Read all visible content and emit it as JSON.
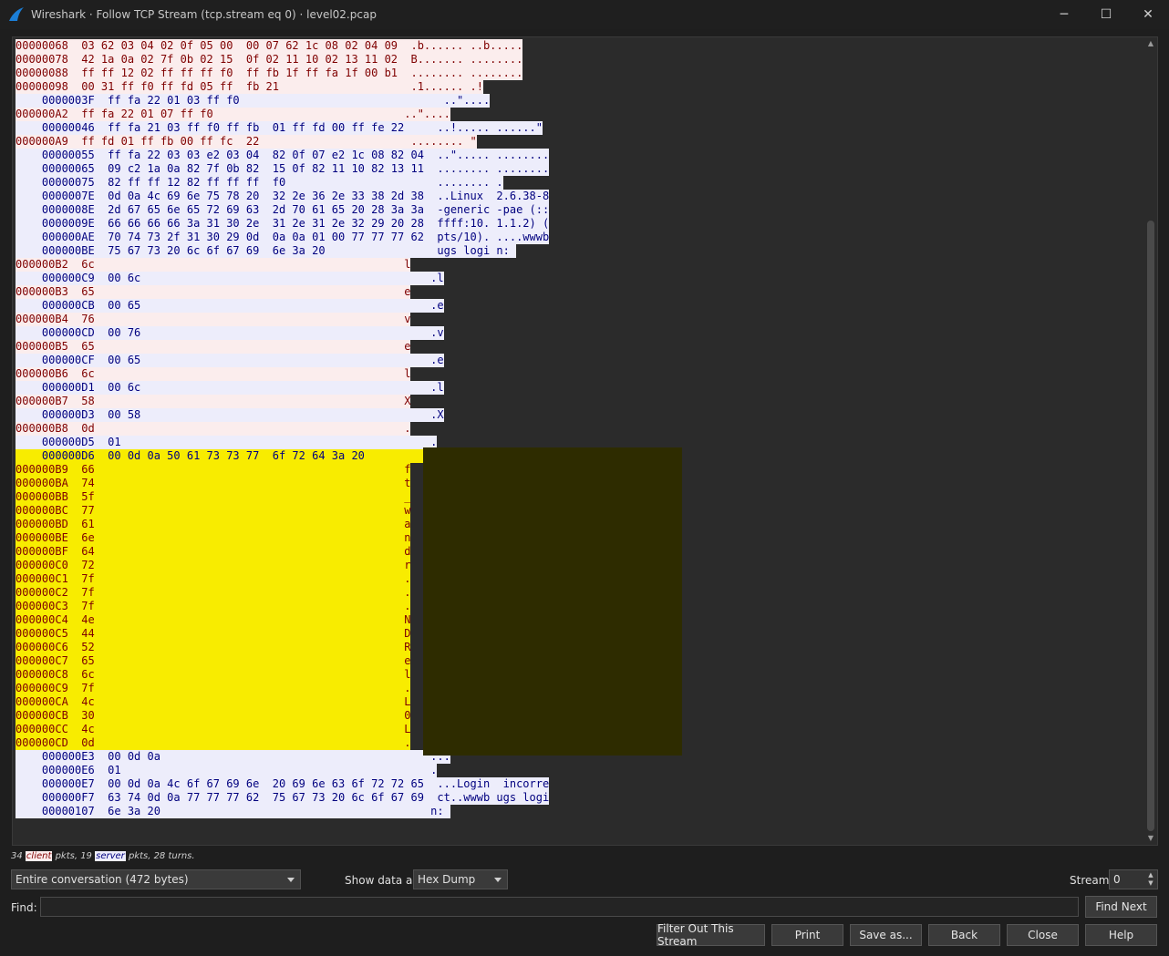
{
  "window": {
    "title": "Wireshark · Follow TCP Stream (tcp.stream eq 0) · level02.pcap",
    "minimize": "─",
    "maximize": "☐",
    "close": "✕"
  },
  "stream": {
    "colors": {
      "client_bg": "#fbeded",
      "client_fg": "#7f0000",
      "server_bg": "#ededfb",
      "server_fg": "#00007f",
      "highlight": "#f8ec00"
    },
    "lines": [
      {
        "who": "c",
        "text": "00000068  03 62 03 04 02 0f 05 00  00 07 62 1c 08 02 04 09  .b...... ..b....."
      },
      {
        "who": "c",
        "text": "00000078  42 1a 0a 02 7f 0b 02 15  0f 02 11 10 02 13 11 02  B....... ........"
      },
      {
        "who": "c",
        "text": "00000088  ff ff 12 02 ff ff ff f0  ff fb 1f ff fa 1f 00 b1  ........ ........"
      },
      {
        "who": "c",
        "text": "00000098  00 31 ff f0 ff fd 05 ff  fb 21                    .1...... .!"
      },
      {
        "who": "s",
        "text": "    0000003F  ff fa 22 01 03 ff f0                               ..\"...."
      },
      {
        "who": "c",
        "text": "000000A2  ff fa 22 01 07 ff f0                             ..\"...."
      },
      {
        "who": "s",
        "text": "    00000046  ff fa 21 03 ff f0 ff fb  01 ff fd 00 ff fe 22     ..!..... ......\""
      },
      {
        "who": "c",
        "text": "000000A9  ff fd 01 ff fb 00 ff fc  22                       ........ \""
      },
      {
        "who": "s",
        "text": "    00000055  ff fa 22 03 03 e2 03 04  82 0f 07 e2 1c 08 82 04  ..\"..... ........"
      },
      {
        "who": "s",
        "text": "    00000065  09 c2 1a 0a 82 7f 0b 82  15 0f 82 11 10 82 13 11  ........ ........"
      },
      {
        "who": "s",
        "text": "    00000075  82 ff ff 12 82 ff ff ff  f0                       ........ ."
      },
      {
        "who": "s",
        "text": "    0000007E  0d 0a 4c 69 6e 75 78 20  32 2e 36 2e 33 38 2d 38  ..Linux  2.6.38-8"
      },
      {
        "who": "s",
        "text": "    0000008E  2d 67 65 6e 65 72 69 63  2d 70 61 65 20 28 3a 3a  -generic -pae (::"
      },
      {
        "who": "s",
        "text": "    0000009E  66 66 66 66 3a 31 30 2e  31 2e 31 2e 32 29 20 28  ffff:10. 1.1.2) ("
      },
      {
        "who": "s",
        "text": "    000000AE  70 74 73 2f 31 30 29 0d  0a 0a 01 00 77 77 77 62  pts/10). ....wwwb"
      },
      {
        "who": "s",
        "text": "    000000BE  75 67 73 20 6c 6f 67 69  6e 3a 20                 ugs logi n: "
      },
      {
        "who": "c",
        "text": "000000B2  6c                                               l"
      },
      {
        "who": "s",
        "text": "    000000C9  00 6c                                            .l"
      },
      {
        "who": "c",
        "text": "000000B3  65                                               e"
      },
      {
        "who": "s",
        "text": "    000000CB  00 65                                            .e"
      },
      {
        "who": "c",
        "text": "000000B4  76                                               v"
      },
      {
        "who": "s",
        "text": "    000000CD  00 76                                            .v"
      },
      {
        "who": "c",
        "text": "000000B5  65                                               e"
      },
      {
        "who": "s",
        "text": "    000000CF  00 65                                            .e"
      },
      {
        "who": "c",
        "text": "000000B6  6c                                               l"
      },
      {
        "who": "s",
        "text": "    000000D1  00 6c                                            .l"
      },
      {
        "who": "c",
        "text": "000000B7  58                                               X"
      },
      {
        "who": "s",
        "text": "    000000D3  00 58                                            .X"
      },
      {
        "who": "c",
        "text": "000000B8  0d                                               ."
      },
      {
        "who": "s",
        "text": "    000000D5  01                                               ."
      },
      {
        "who": "hs",
        "text": "    000000D6  00 0d 0a 50 61 73 73 77  6f 72 64 3a 20           ...Passw ord: "
      },
      {
        "who": "h",
        "text": "000000B9  66                                               f"
      },
      {
        "who": "h",
        "text": "000000BA  74                                               t"
      },
      {
        "who": "h",
        "text": "000000BB  5f                                               _"
      },
      {
        "who": "h",
        "text": "000000BC  77                                               w"
      },
      {
        "who": "h",
        "text": "000000BD  61                                               a"
      },
      {
        "who": "h",
        "text": "000000BE  6e                                               n"
      },
      {
        "who": "h",
        "text": "000000BF  64                                               d"
      },
      {
        "who": "h",
        "text": "000000C0  72                                               r"
      },
      {
        "who": "h",
        "text": "000000C1  7f                                               ."
      },
      {
        "who": "h",
        "text": "000000C2  7f                                               ."
      },
      {
        "who": "h",
        "text": "000000C3  7f                                               ."
      },
      {
        "who": "h",
        "text": "000000C4  4e                                               N"
      },
      {
        "who": "h",
        "text": "000000C5  44                                               D"
      },
      {
        "who": "h",
        "text": "000000C6  52                                               R"
      },
      {
        "who": "h",
        "text": "000000C7  65                                               e"
      },
      {
        "who": "h",
        "text": "000000C8  6c                                               l"
      },
      {
        "who": "h",
        "text": "000000C9  7f                                               ."
      },
      {
        "who": "h",
        "text": "000000CA  4c                                               L"
      },
      {
        "who": "h",
        "text": "000000CB  30                                               0"
      },
      {
        "who": "h",
        "text": "000000CC  4c                                               L"
      },
      {
        "who": "h",
        "text": "000000CD  0d                                               ."
      },
      {
        "who": "s",
        "text": "    000000E3  00 0d 0a                                         ..."
      },
      {
        "who": "s",
        "text": "    000000E6  01                                               ."
      },
      {
        "who": "s",
        "text": "    000000E7  00 0d 0a 4c 6f 67 69 6e  20 69 6e 63 6f 72 72 65  ...Login  incorre"
      },
      {
        "who": "s",
        "text": "    000000F7  63 74 0d 0a 77 77 77 62  75 67 73 20 6c 6f 67 69  ct..wwwb ugs logi"
      },
      {
        "who": "s",
        "text": "    00000107  6e 3a 20                                         n: "
      }
    ]
  },
  "stats": {
    "client_pkts": "34",
    "client_label": "client",
    "mid": " pkts, 19 ",
    "server_label": "server",
    "tail": " pkts, 28 turns."
  },
  "controls": {
    "conversation": "Entire conversation (472 bytes)",
    "show_data_label": "Show data as",
    "show_data_value": "Hex Dump",
    "stream_label": "Stream",
    "stream_value": "0",
    "find_label": "Find:",
    "find_value": "",
    "find_next": "Find Next"
  },
  "buttons": {
    "filter_out": "Filter Out This Stream",
    "print": "Print",
    "save_as": "Save as...",
    "back": "Back",
    "close": "Close",
    "help": "Help"
  }
}
